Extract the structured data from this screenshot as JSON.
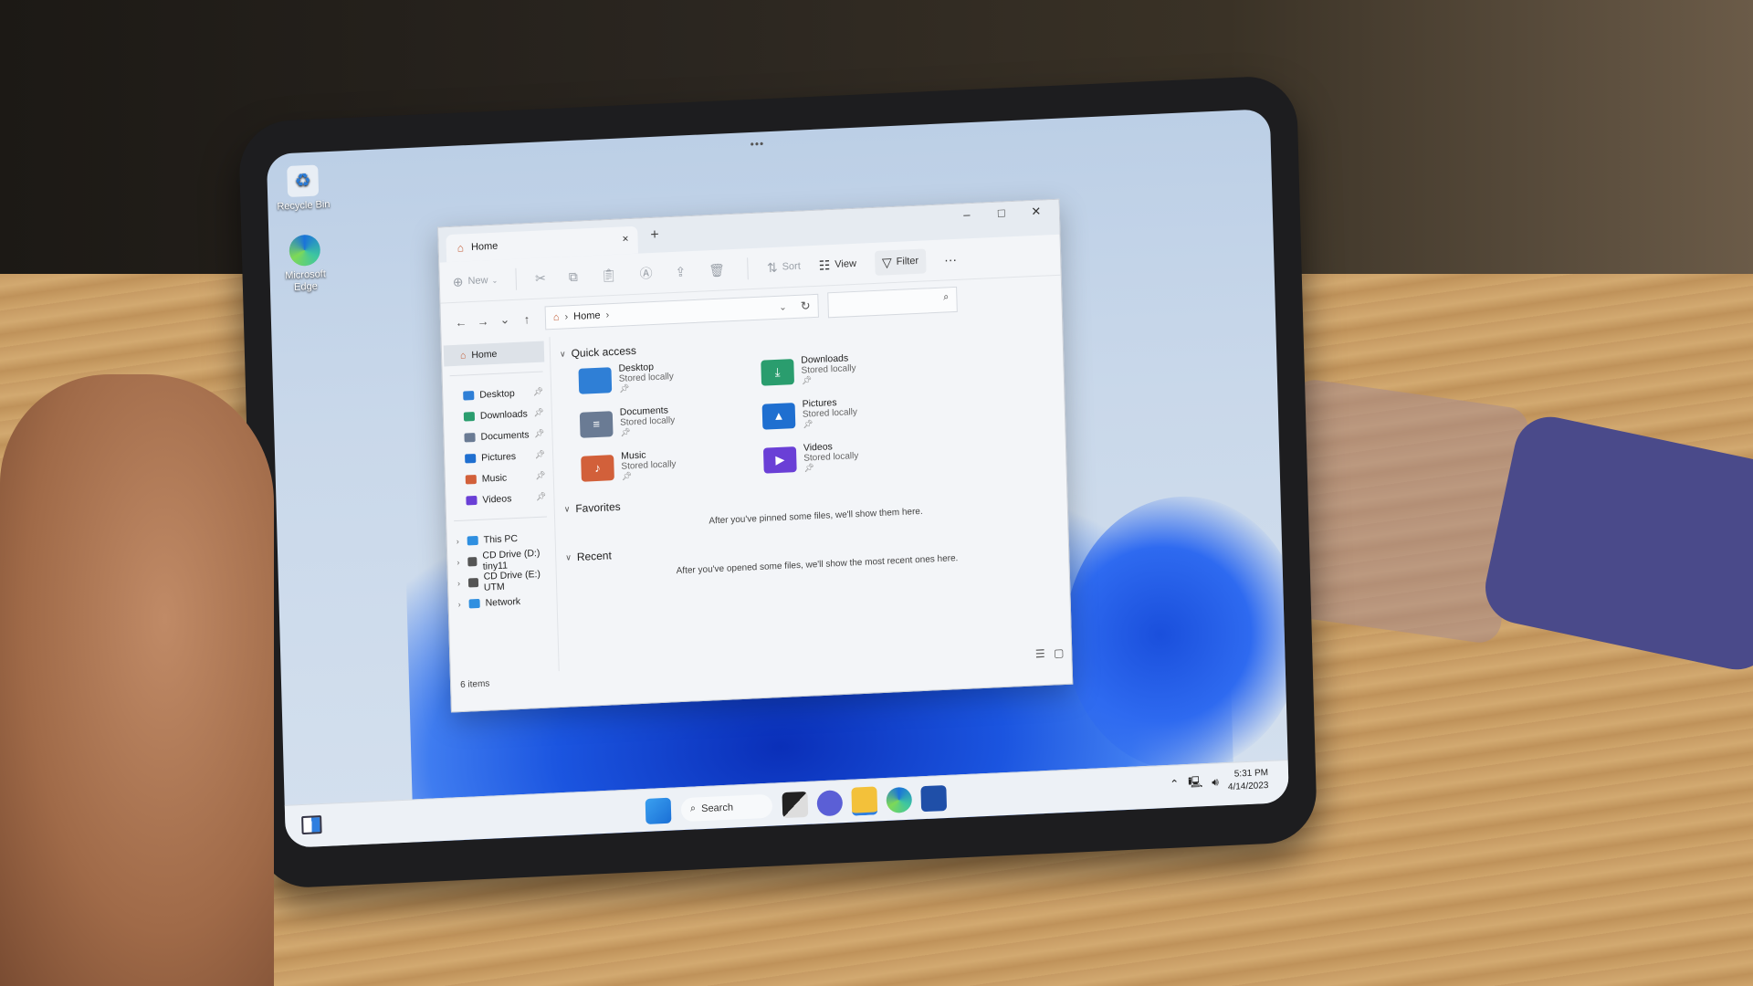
{
  "desktop": {
    "icons": [
      {
        "label": "Recycle Bin",
        "icon": "recycle-bin-icon"
      },
      {
        "label": "Microsoft Edge",
        "icon": "edge-icon"
      }
    ]
  },
  "window": {
    "tab_title": "Home",
    "tab_close": "×",
    "new_tab": "+",
    "minimize": "–",
    "maximize": "□",
    "close": "✕"
  },
  "toolbar": {
    "new_label": "New",
    "sort_label": "Sort",
    "view_label": "View",
    "filter_label": "Filter",
    "more": "···"
  },
  "navigation": {
    "back": "←",
    "forward": "→",
    "recent": "⌄",
    "up": "↑",
    "breadcrumb": [
      "Home"
    ],
    "search_placeholder": ""
  },
  "sidebar": {
    "home": "Home",
    "pinned": [
      {
        "label": "Desktop",
        "color": "#2f7fd6"
      },
      {
        "label": "Downloads",
        "color": "#2a9d6e"
      },
      {
        "label": "Documents",
        "color": "#6a7b94"
      },
      {
        "label": "Pictures",
        "color": "#1f6fd0"
      },
      {
        "label": "Music",
        "color": "#d2603a"
      },
      {
        "label": "Videos",
        "color": "#6a3fd6"
      }
    ],
    "locations": [
      {
        "label": "This PC",
        "color": "#2f8fe0"
      },
      {
        "label": "CD Drive (D:) tiny11",
        "color": "#555555"
      },
      {
        "label": "CD Drive (E:) UTM",
        "color": "#555555"
      },
      {
        "label": "Network",
        "color": "#2f8fe0"
      }
    ]
  },
  "main": {
    "quick_access_title": "Quick access",
    "quick_access": [
      {
        "name": "Desktop",
        "sub": "Stored locally",
        "color": "#2f7fd6",
        "glyph": ""
      },
      {
        "name": "Downloads",
        "sub": "Stored locally",
        "color": "#2a9d6e",
        "glyph": "⤓"
      },
      {
        "name": "Documents",
        "sub": "Stored locally",
        "color": "#6a7b94",
        "glyph": "≡"
      },
      {
        "name": "Pictures",
        "sub": "Stored locally",
        "color": "#1f6fd0",
        "glyph": "▲"
      },
      {
        "name": "Music",
        "sub": "Stored locally",
        "color": "#d2603a",
        "glyph": "♪"
      },
      {
        "name": "Videos",
        "sub": "Stored locally",
        "color": "#6a3fd6",
        "glyph": "▶"
      }
    ],
    "favorites_title": "Favorites",
    "favorites_empty": "After you've pinned some files, we'll show them here.",
    "recent_title": "Recent",
    "recent_empty": "After you've opened some files, we'll show the most recent ones here."
  },
  "status": {
    "items": "6 items"
  },
  "taskbar": {
    "search_label": "Search",
    "time": "5:31 PM",
    "date": "4/14/2023"
  }
}
